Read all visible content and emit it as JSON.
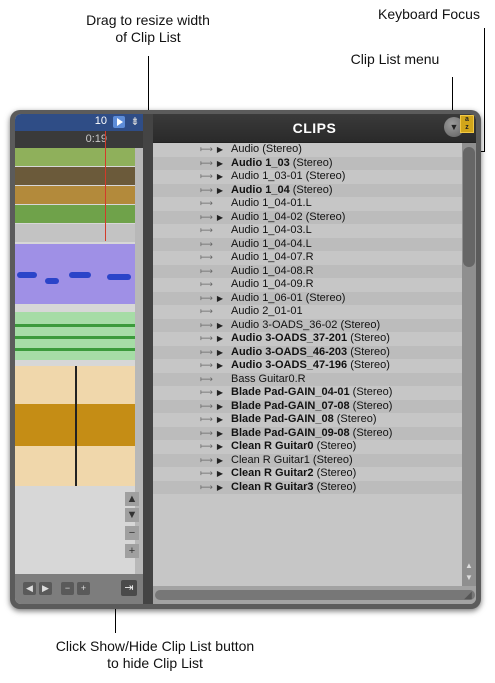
{
  "annotations": {
    "resize": "Drag to resize width\nof Clip List",
    "keyboard_focus": "Keyboard Focus",
    "clip_menu": "Clip List menu",
    "show_hide": "Click Show/Hide Clip List button\nto hide Clip List"
  },
  "edit_window": {
    "timecode": "10",
    "time": "0:19",
    "track_colors": [
      "#8fb05b",
      "#6b5a3a",
      "#b38a3b",
      "#6fa24a",
      "#c3c3c3"
    ]
  },
  "clips": {
    "title": "CLIPS",
    "menu_icon": "chevron-down-icon",
    "az_label": "a z",
    "items": [
      {
        "bold": "",
        "normal": "Audio (Stereo)",
        "expand": true
      },
      {
        "bold": "Audio 1_03",
        "normal": " (Stereo)",
        "expand": true
      },
      {
        "bold": "",
        "normal": "Audio 1_03-01 (Stereo)",
        "expand": true
      },
      {
        "bold": "Audio 1_04",
        "normal": " (Stereo)",
        "expand": true
      },
      {
        "bold": "",
        "normal": "Audio 1_04-01.L",
        "expand": false
      },
      {
        "bold": "",
        "normal": "Audio 1_04-02 (Stereo)",
        "expand": true
      },
      {
        "bold": "",
        "normal": "Audio 1_04-03.L",
        "expand": false
      },
      {
        "bold": "",
        "normal": "Audio 1_04-04.L",
        "expand": false
      },
      {
        "bold": "",
        "normal": "Audio 1_04-07.R",
        "expand": false
      },
      {
        "bold": "",
        "normal": "Audio 1_04-08.R",
        "expand": false
      },
      {
        "bold": "",
        "normal": "Audio 1_04-09.R",
        "expand": false
      },
      {
        "bold": "",
        "normal": "Audio 1_06-01 (Stereo)",
        "expand": true
      },
      {
        "bold": "",
        "normal": "Audio 2_01-01",
        "expand": false
      },
      {
        "bold": "",
        "normal": "Audio 3-OADS_36-02 (Stereo)",
        "expand": true
      },
      {
        "bold": "Audio 3-OADS_37-201",
        "normal": " (Stereo)",
        "expand": true
      },
      {
        "bold": "Audio 3-OADS_46-203",
        "normal": " (Stereo)",
        "expand": true
      },
      {
        "bold": "Audio 3-OADS_47-196",
        "normal": " (Stereo)",
        "expand": true
      },
      {
        "bold": "",
        "normal": "Bass Guitar0.R",
        "expand": false
      },
      {
        "bold": "Blade Pad-GAIN_04-01",
        "normal": " (Stereo)",
        "expand": true
      },
      {
        "bold": "Blade Pad-GAIN_07-08",
        "normal": " (Stereo)",
        "expand": true
      },
      {
        "bold": "Blade Pad-GAIN_08",
        "normal": " (Stereo)",
        "expand": true
      },
      {
        "bold": "Blade Pad-GAIN_09-08",
        "normal": " (Stereo)",
        "expand": true
      },
      {
        "bold": "Clean R Guitar0",
        "normal": " (Stereo)",
        "expand": true
      },
      {
        "bold": "",
        "normal": "Clean R Guitar1 (Stereo)",
        "expand": true
      },
      {
        "bold": "Clean R Guitar2",
        "normal": " (Stereo)",
        "expand": true
      },
      {
        "bold": "Clean R Guitar3",
        "normal": " (Stereo)",
        "expand": true
      }
    ]
  },
  "colors": {
    "header": "#2f2f2f",
    "timecode_bar": "#2f4d86",
    "focus": "#d1a51a",
    "playhead": "#d23b2a"
  }
}
